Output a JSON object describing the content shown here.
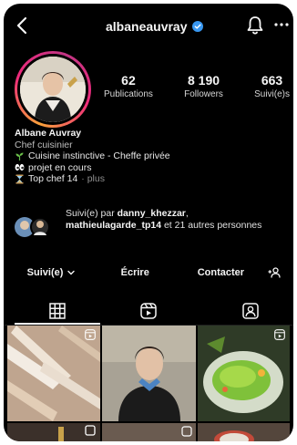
{
  "header": {
    "username": "albaneauvray"
  },
  "stats": [
    {
      "value": "62",
      "label": "Publications"
    },
    {
      "value": "8 190",
      "label": "Followers"
    },
    {
      "value": "663",
      "label": "Suivi(e)s"
    }
  ],
  "bio": {
    "name": "Albane Auvray",
    "category": "Chef cuisinier",
    "line1": "Cuisine instinctive - Cheffe privée",
    "line2": "projet en cours",
    "line3": "Top chef 14",
    "more": "· plus"
  },
  "followed_by": {
    "prefix": "Suivi(e) par",
    "user1": "danny_khezzar",
    "sep": ",",
    "user2": "mathieulagarde_tp14",
    "suffix": "et 21 autres personnes"
  },
  "actions": {
    "follow": "Suivi(e)",
    "message": "Écrire",
    "contact": "Contacter"
  },
  "icons": {
    "back": "chevron-left-icon",
    "verified": "verified-badge-icon",
    "bell": "bell-icon",
    "more": "more-horizontal-icon",
    "grid_tab": "grid-icon",
    "reels_tab": "reels-icon",
    "tagged_tab": "tagged-icon",
    "add_person": "add-person-icon"
  },
  "colors": {
    "background": "#000000",
    "verified": "#3897f0",
    "text": "#f5f5f5",
    "muted": "#8e8e8e"
  }
}
